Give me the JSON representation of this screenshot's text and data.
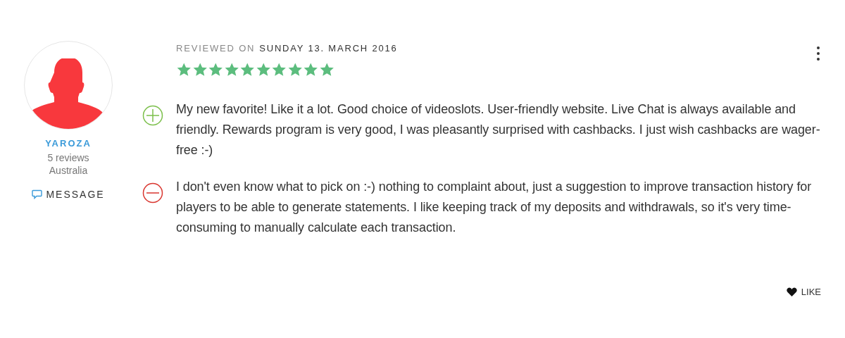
{
  "reviewer": {
    "name": "YAROZA",
    "reviews": "5 reviews",
    "country": "Australia",
    "message_label": "MESSAGE"
  },
  "review": {
    "date_prefix": "REVIEWED ON",
    "date": "SUNDAY 13. MARCH 2016",
    "stars": 10,
    "points": [
      {
        "kind": "pro",
        "text": "My new favorite! Like it a lot. Good choice of videoslots. User-friendly website. Live Chat is always available and friendly. Rewards program is very good, I was pleasantly surprised with cashbacks. I just wish cashbacks are wager-free :-)"
      },
      {
        "kind": "con",
        "text": "I don't even know what to pick on :-) nothing to complaint about, just a suggestion to improve transaction history for players to be able to generate statements. I like keeping track of my deposits and withdrawals, so it's very time-consuming to manually calculate each transaction."
      }
    ],
    "like_label": "LIKE"
  }
}
